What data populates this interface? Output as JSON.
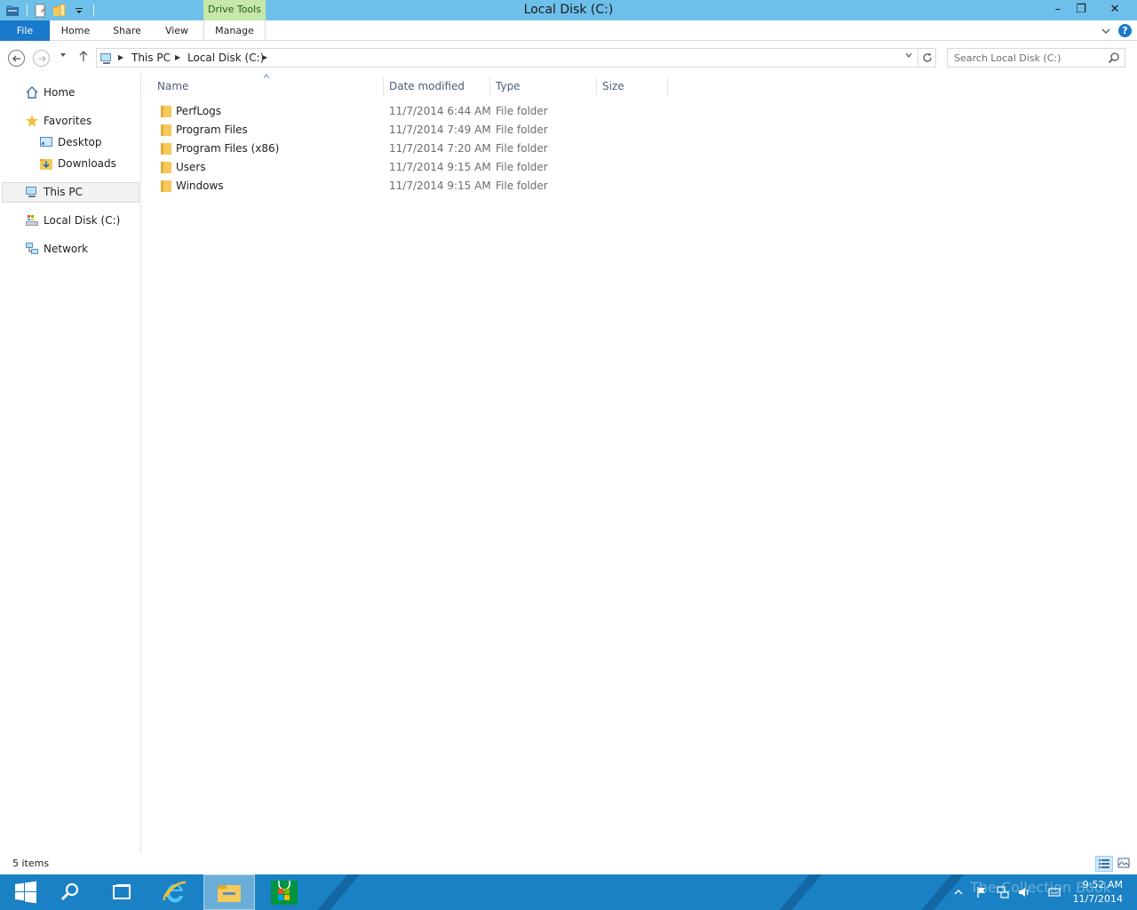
{
  "window": {
    "title": "Local Disk (C:)",
    "context_tab_group": "Drive Tools",
    "controls": {
      "minimize": "–",
      "restore": "❐",
      "close": "✕"
    }
  },
  "ribbon": {
    "tabs": [
      "File",
      "Home",
      "Share",
      "View",
      "Manage"
    ],
    "expand_icon": "chevron-down-icon",
    "help": "?"
  },
  "address_bar": {
    "breadcrumbs": [
      "This PC",
      "Local Disk (C:)"
    ],
    "search_placeholder": "Search Local Disk (C:)"
  },
  "navigation_pane": {
    "items": [
      {
        "label": "Home",
        "icon": "home-icon"
      },
      {
        "label": "Favorites",
        "icon": "star-icon"
      },
      {
        "label": "Desktop",
        "icon": "desktop-icon"
      },
      {
        "label": "Downloads",
        "icon": "downloads-folder-icon"
      },
      {
        "label": "This PC",
        "icon": "computer-icon",
        "selected": true
      },
      {
        "label": "Local Disk (C:)",
        "icon": "drive-icon"
      },
      {
        "label": "Network",
        "icon": "network-icon"
      }
    ]
  },
  "file_list": {
    "columns": [
      "Name",
      "Date modified",
      "Type",
      "Size"
    ],
    "sorted_by": "Name",
    "rows": [
      {
        "name": "PerfLogs",
        "date": "11/7/2014 6:44 AM",
        "type": "File folder",
        "size": ""
      },
      {
        "name": "Program Files",
        "date": "11/7/2014 7:49 AM",
        "type": "File folder",
        "size": ""
      },
      {
        "name": "Program Files (x86)",
        "date": "11/7/2014 7:20 AM",
        "type": "File folder",
        "size": ""
      },
      {
        "name": "Users",
        "date": "11/7/2014 9:15 AM",
        "type": "File folder",
        "size": ""
      },
      {
        "name": "Windows",
        "date": "11/7/2014 9:15 AM",
        "type": "File folder",
        "size": ""
      }
    ]
  },
  "status_bar": {
    "item_count": "5 items",
    "active_view": "details"
  },
  "taskbar": {
    "buttons": [
      "start-icon",
      "search-icon",
      "task-view-icon",
      "internet-explorer-icon",
      "file-explorer-icon",
      "store-icon"
    ],
    "active": "file-explorer-icon",
    "clock_time": "9:52 AM",
    "clock_date": "11/7/2014",
    "watermark": "The Collection Book"
  },
  "colors": {
    "titlebar": "#6ebfea",
    "context_tab": "#c5e8a8",
    "file_tab": "#1979ca",
    "taskbar": "#1a81c4",
    "folder": "#f5c95a",
    "column_header_text": "#4c607a"
  }
}
